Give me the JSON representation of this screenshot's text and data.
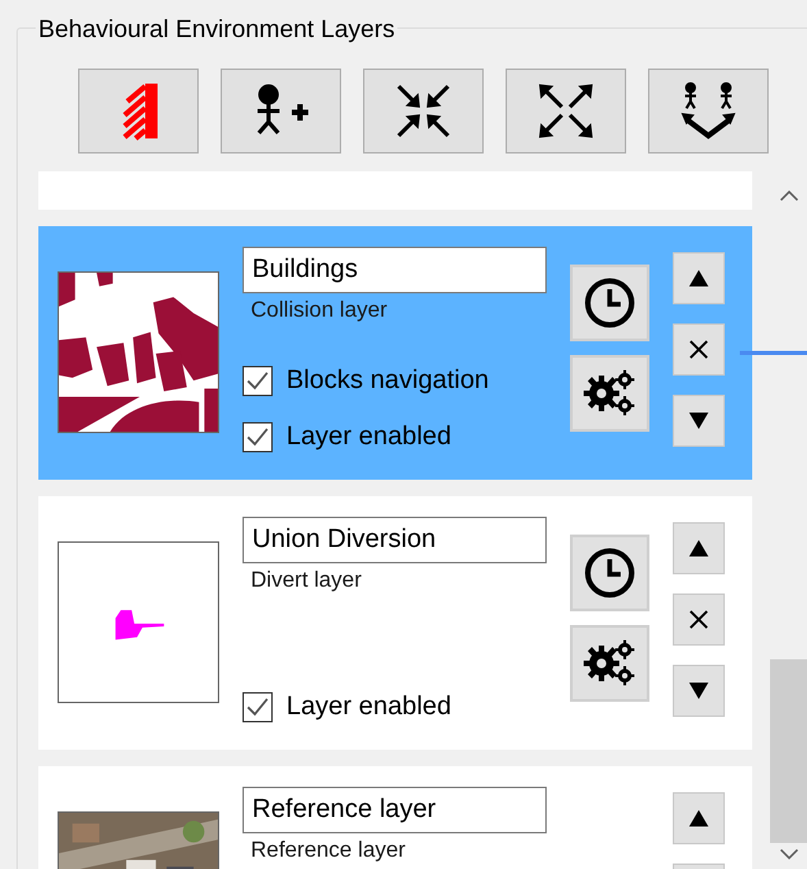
{
  "group": {
    "title": "Behavioural Environment Layers"
  },
  "layers": [
    {
      "kind": "collision",
      "name": "Buildings",
      "type_label": "Collision layer",
      "selected": true,
      "blocks_navigation": {
        "label": "Blocks navigation",
        "checked": true
      },
      "enabled": {
        "label": "Layer enabled",
        "checked": true
      }
    },
    {
      "kind": "divert",
      "name": "Union Diversion",
      "type_label": "Divert layer",
      "selected": false,
      "enabled": {
        "label": "Layer enabled",
        "checked": true
      }
    },
    {
      "kind": "reference",
      "name": "Reference layer",
      "type_label": "Reference layer",
      "selected": false
    }
  ]
}
